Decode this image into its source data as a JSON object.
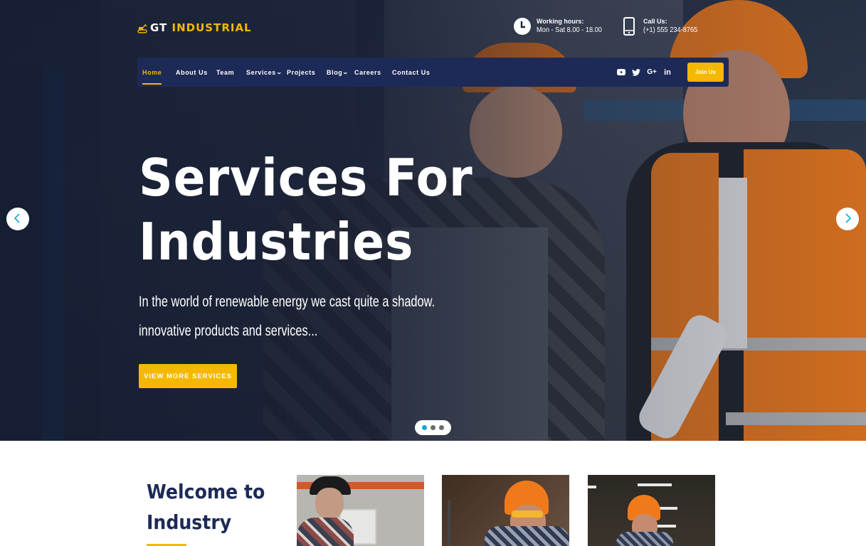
{
  "brand": {
    "logo_prefix": "GT",
    "logo_suffix": "INDUSTRIAL",
    "logo_icon": "excavator-icon",
    "accent_color": "#f5b800",
    "nav_color": "#1d2a57",
    "active_dot_color": "#17a7d0"
  },
  "contact": {
    "hours_label": "Working hours:",
    "hours_value": "Mon - Sat 8.00 - 18.00",
    "hours_icon": "clock-icon",
    "call_label": "Call Us:",
    "call_value": "(+1) 555 234-8765",
    "call_icon": "phone-icon"
  },
  "nav": {
    "items": [
      {
        "label": "Home",
        "active": true,
        "dropdown": false
      },
      {
        "label": "About Us",
        "active": false,
        "dropdown": false
      },
      {
        "label": "Team",
        "active": false,
        "dropdown": false
      },
      {
        "label": "Services",
        "active": false,
        "dropdown": true
      },
      {
        "label": "Projects",
        "active": false,
        "dropdown": false
      },
      {
        "label": "Blog",
        "active": false,
        "dropdown": true
      },
      {
        "label": "Careers",
        "active": false,
        "dropdown": false
      },
      {
        "label": "Contact Us",
        "active": false,
        "dropdown": false
      }
    ],
    "chevron": "⌄",
    "social": [
      "youtube-icon",
      "twitter-icon",
      "google-plus-icon",
      "linkedin-icon"
    ],
    "join_label": "Join Us"
  },
  "hero": {
    "title_line1": "Services For",
    "title_line2": "Industries",
    "subtitle_line1": "In the world of renewable energy we cast quite a shadow.",
    "subtitle_line2": "innovative products and services...",
    "cta_label": "VIEW MORE SERVICES",
    "slider": {
      "total_slides": 3,
      "active_slide": 1
    }
  },
  "welcome": {
    "title_line1": "Welcome to",
    "title_line2": "Industry",
    "cards": [
      {
        "alt": "Worker in black cap and plaid shirt at control panel"
      },
      {
        "alt": "Worker in orange hard hat and safety glasses operating machine"
      },
      {
        "alt": "Worker in orange hard hat in factory hall"
      }
    ]
  }
}
